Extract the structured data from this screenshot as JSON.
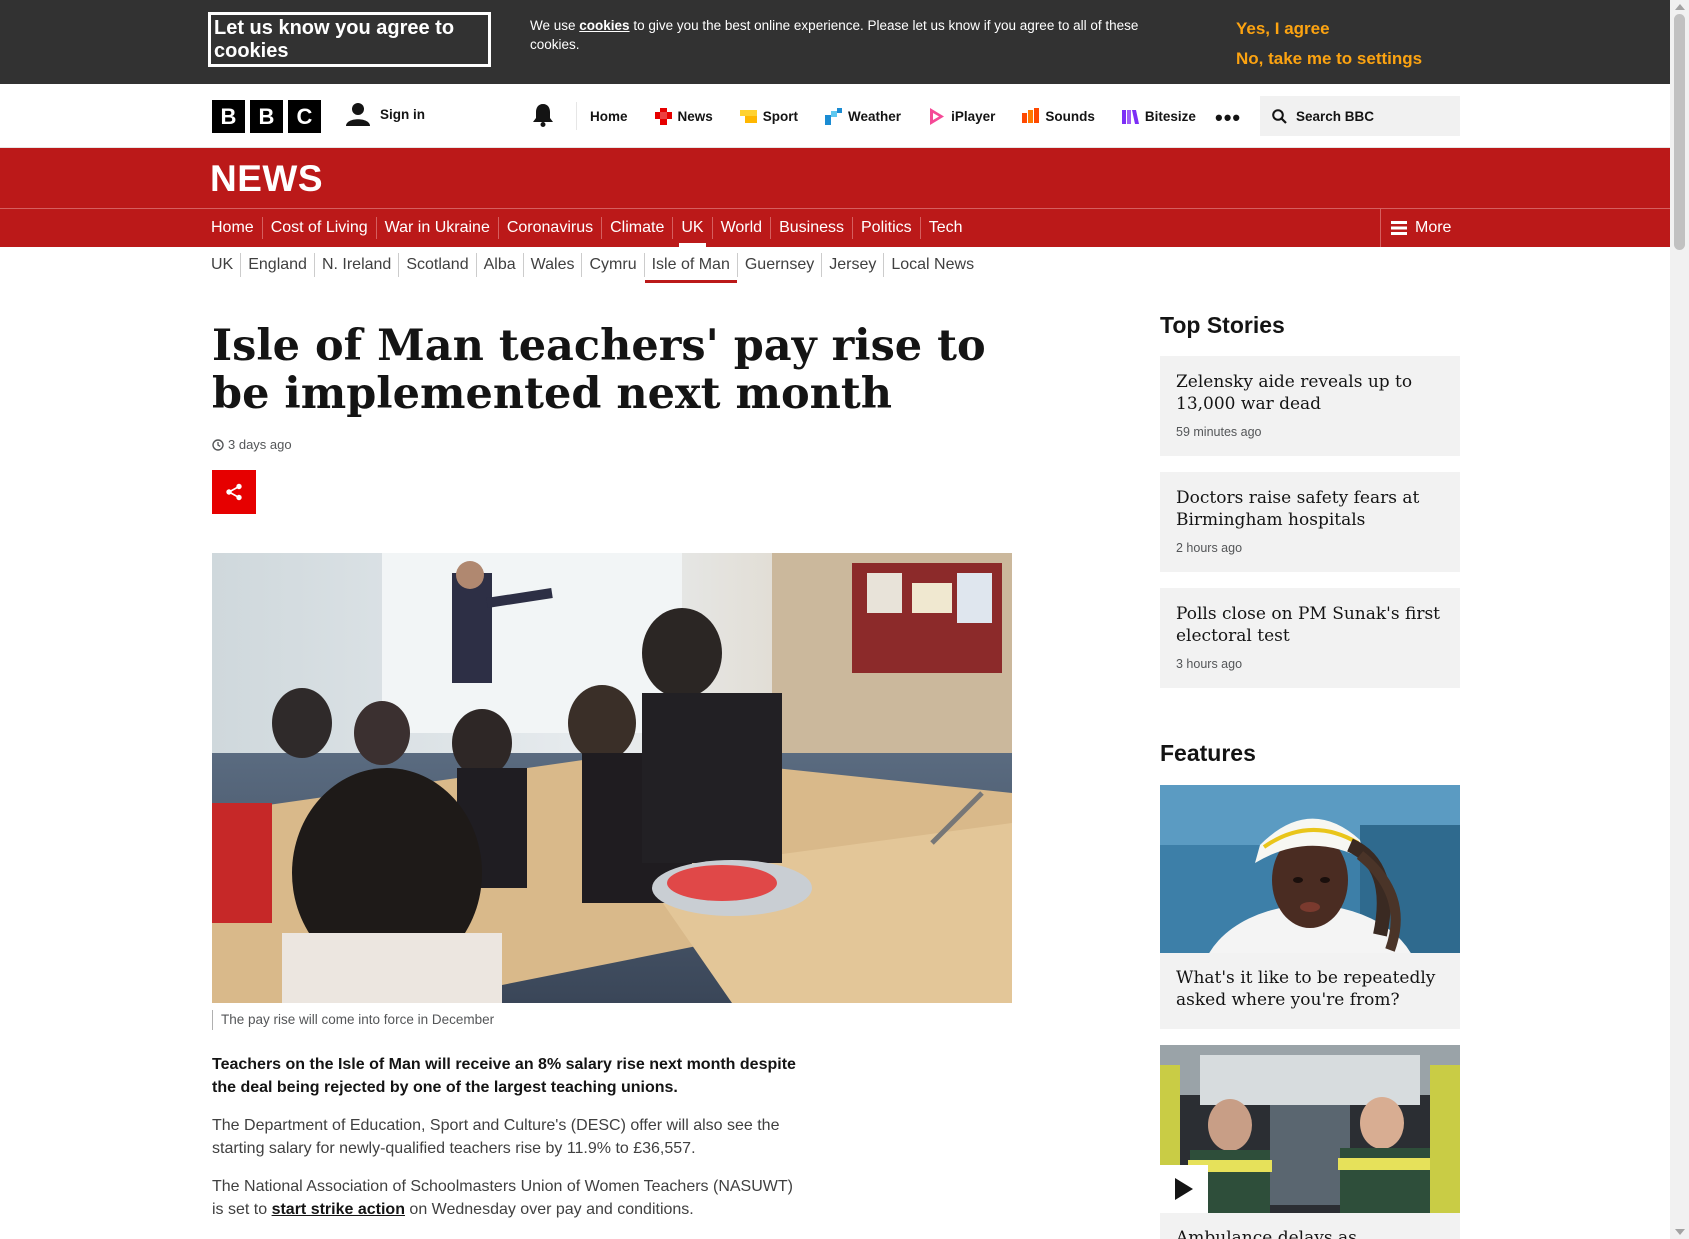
{
  "cookie_banner": {
    "title": "Let us know you agree to cookies",
    "text_before": "We use ",
    "link": "cookies",
    "text_after": " to give you the best online experience. Please let us know if you agree to all of these cookies.",
    "agree": "Yes, I agree",
    "settings": "No, take me to settings"
  },
  "global_nav": {
    "logo": [
      "B",
      "B",
      "C"
    ],
    "sign_in": "Sign in",
    "items": [
      {
        "label": "Home",
        "icon": "none"
      },
      {
        "label": "News",
        "icon": "news-icon",
        "color": "#e60000"
      },
      {
        "label": "Sport",
        "icon": "sport-icon",
        "color": "#ffd230"
      },
      {
        "label": "Weather",
        "icon": "weather-icon",
        "color": "#1b8cd3"
      },
      {
        "label": "iPlayer",
        "icon": "iplayer-icon",
        "color": "#f54997"
      },
      {
        "label": "Sounds",
        "icon": "sounds-icon",
        "color": "#ff4900"
      },
      {
        "label": "Bitesize",
        "icon": "bitesize-icon",
        "color": "#7c2ef6"
      }
    ],
    "more": "•••",
    "search_placeholder": "Search BBC"
  },
  "news": {
    "masthead": "NEWS",
    "nav": [
      "Home",
      "Cost of Living",
      "War in Ukraine",
      "Coronavirus",
      "Climate",
      "UK",
      "World",
      "Business",
      "Politics",
      "Tech"
    ],
    "active_nav": "UK",
    "more": "More",
    "sub_nav": [
      "UK",
      "England",
      "N. Ireland",
      "Scotland",
      "Alba",
      "Wales",
      "Cymru",
      "Isle of Man",
      "Guernsey",
      "Jersey",
      "Local News"
    ],
    "active_sub_nav": "Isle of Man",
    "brand_red": "#bb1919"
  },
  "article": {
    "headline": "Isle of Man teachers' pay rise to be implemented next month",
    "timestamp": "3 days ago",
    "caption": "The pay rise will come into force in December",
    "lead": "Teachers on the Isle of Man will receive an 8% salary rise next month despite the deal being rejected by one of the largest teaching unions.",
    "para1": "The Department of Education, Sport and Culture's (DESC) offer will also see the starting salary for newly-qualified teachers rise by 11.9% to £36,557.",
    "para2_before": "The National Association of Schoolmasters Union of Women Teachers (NASUWT) is set to ",
    "para2_link": "start strike action",
    "para2_after": " on Wednesday over pay and conditions."
  },
  "sidebar": {
    "top_stories_heading": "Top Stories",
    "top_stories": [
      {
        "title": "Zelensky aide reveals up to 13,000 war dead",
        "ago": "59 minutes ago"
      },
      {
        "title": "Doctors raise safety fears at Birmingham hospitals",
        "ago": "2 hours ago"
      },
      {
        "title": "Polls close on PM Sunak's first electoral test",
        "ago": "3 hours ago"
      }
    ],
    "features_heading": "Features",
    "features": [
      {
        "title": "What's it like to be repeatedly asked where you're from?"
      },
      {
        "title": "Ambulance delays as..."
      }
    ]
  }
}
